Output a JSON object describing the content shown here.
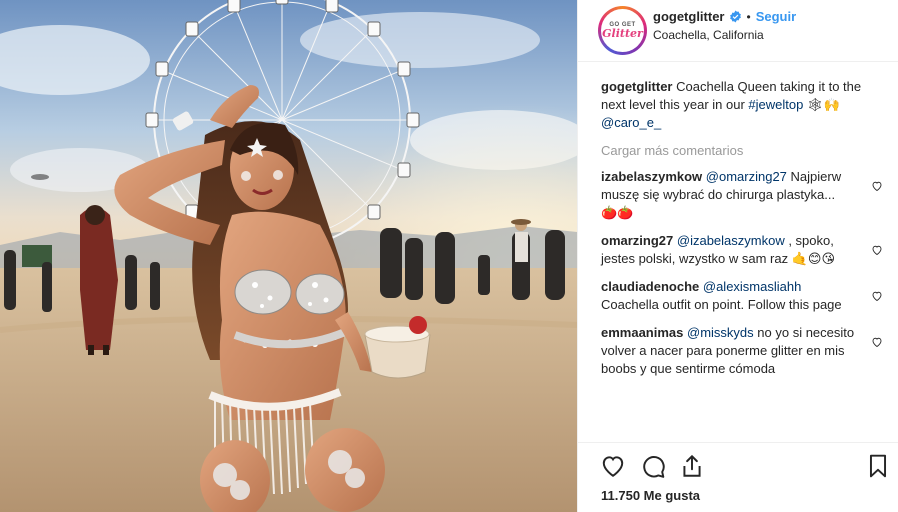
{
  "post": {
    "username": "gogetglitter",
    "follow_label": "Seguir",
    "dot": "•",
    "location": "Coachella, California",
    "avatar": {
      "line1": "GO GET",
      "line2": "Glitter"
    },
    "caption": {
      "username": "gogetglitter",
      "text": " Coachella Queen taking it to the next level this year in our ",
      "hashtag": "#jeweltop",
      "emoji": " 🕸🙌",
      "mention": "@caro_e_"
    },
    "load_more": "Cargar más comentarios",
    "comments": [
      {
        "user": "izabelaszymkow",
        "mention": "@omarzing27",
        "text": " Najpierw muszę się wybrać do chirurga plastyka...",
        "emoji": "🍅🍅"
      },
      {
        "user": "omarzing27",
        "mention": "@izabelaszymkow",
        "text": " , spoko, jestes polski, wzystko w sam raz ",
        "emoji": "🤙😊😘"
      },
      {
        "user": "claudiadenoche",
        "mention": "@alexismasliahh",
        "text": "Coachella outfit on point. Follow this page",
        "emoji": ""
      },
      {
        "user": "emmaanimas",
        "mention": "@misskyds",
        "text": " no yo si necesito volver a nacer para ponerme glitter en mis boobs y que sentirme cómoda",
        "emoji": ""
      }
    ],
    "likes": "11.750 Me gusta"
  },
  "colors": {
    "link": "#003569",
    "follow": "#3897f0",
    "muted": "#999999",
    "text": "#262626",
    "tomato": "#e53935"
  },
  "icons": [
    "verified-badge-icon",
    "heart-icon",
    "comment-icon",
    "share-icon",
    "bookmark-icon",
    "heart-small-icon"
  ]
}
